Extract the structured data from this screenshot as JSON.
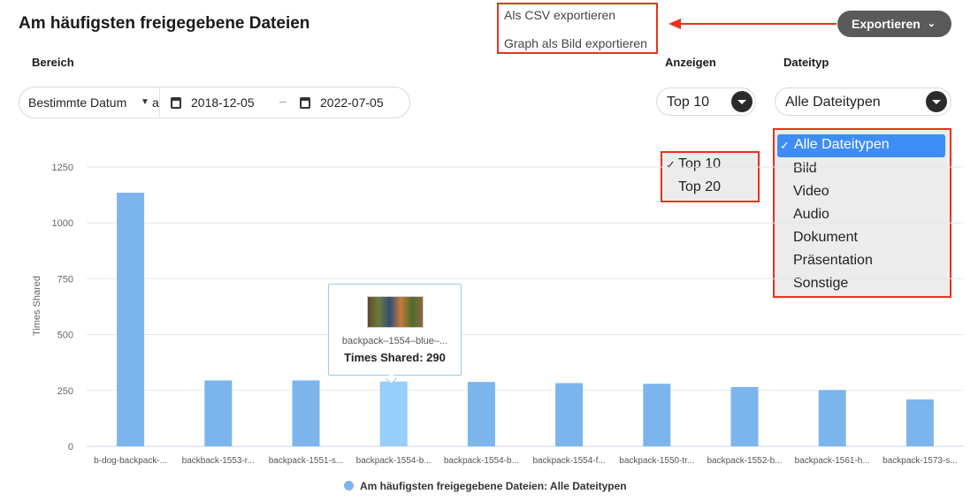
{
  "header": {
    "title": "Am häufigsten freigegebene Dateien",
    "export_label": "Exportieren",
    "export_menu": [
      "Als CSV exportieren",
      "Graph als Bild exportieren"
    ]
  },
  "filters": {
    "range_label": "Bereich",
    "range_value": "Bestimmte Datum",
    "range_overflow": "a",
    "date_from": "2018-12-05",
    "date_sep": "–",
    "date_to": "2022-07-05",
    "show_label": "Anzeigen",
    "show_value": "Top 10",
    "show_options": [
      "Top 10",
      "Top 20"
    ],
    "type_label": "Dateityp",
    "type_value": "Alle Dateitypen",
    "type_options": [
      "Alle Dateitypen",
      "Bild",
      "Video",
      "Audio",
      "Dokument",
      "Präsentation",
      "Sonstige"
    ]
  },
  "tooltip": {
    "name": "backpack–1554–blue–...",
    "value_text": "Times Shared: 290"
  },
  "colors": {
    "bar": "#7cb5ec",
    "bar_hover": "#97cefa",
    "annotation": "#e8331c"
  },
  "chart_data": {
    "type": "bar",
    "categories": [
      "b-dog-backpack-...",
      "backback-1553-r...",
      "backpack-1551-s...",
      "backpack-1554-b...",
      "backpack-1554-b...",
      "backpack-1554-f...",
      "backpack-1550-tr...",
      "backpack-1552-b...",
      "backpack-1561-h...",
      "backpack-1573-s..."
    ],
    "values": [
      1135,
      295,
      295,
      290,
      288,
      283,
      280,
      265,
      252,
      210
    ],
    "ylabel": "Times Shared",
    "yticks": [
      0,
      250,
      500,
      750,
      1000,
      1250
    ],
    "ylim": [
      0,
      1250
    ],
    "highlight_index": 3,
    "legend": "Am häufigsten freigegebene Dateien: Alle Dateitypen",
    "grid": true,
    "legend_position": "bottom-center"
  }
}
